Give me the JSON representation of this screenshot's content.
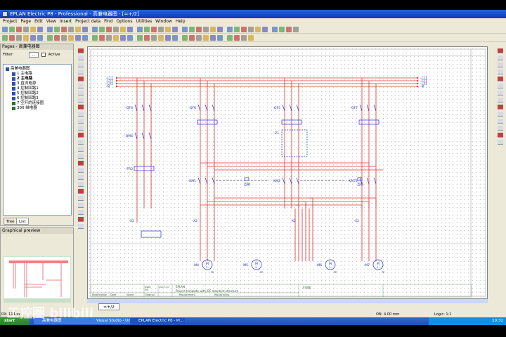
{
  "window": {
    "title": "EPLAN Electric P8 - Professional - 高兼电器图 - [=+/2]"
  },
  "menu": [
    "Project",
    "Page",
    "Edit",
    "View",
    "Insert",
    "Project data",
    "Find",
    "Options",
    "Utilities",
    "Window",
    "Help"
  ],
  "pages_panel": {
    "title": "Pages - 高兼电器图",
    "filter_label": "Filter:",
    "filter_button": "...",
    "active_label": "Active",
    "tree": [
      {
        "label": "高兼电器图",
        "bold": false
      },
      {
        "label": "1 主电路"
      },
      {
        "label": "2 主电路",
        "bold": true
      },
      {
        "label": "3 直流电源"
      },
      {
        "label": "4 控制回路1"
      },
      {
        "label": "5 控制回路2"
      },
      {
        "label": "6 控制回路3"
      },
      {
        "label": "7 空开的连接图"
      },
      {
        "label": "300 继电器"
      }
    ],
    "tabs": [
      "Tree",
      "List"
    ]
  },
  "preview_panel": {
    "title": "Graphical preview"
  },
  "schematic": {
    "bus": [
      "-L11",
      "-L21",
      "-L31",
      "-N"
    ],
    "devices": [
      "-QF4",
      "-QF6",
      "-QF5",
      "-QF7",
      "-QM4",
      "-FR2",
      "-Z1",
      "-KM1",
      "-KM2",
      "-KM72",
      "-X2",
      "-M4",
      "-M5",
      "-M6",
      "-M7"
    ],
    "interlock": "互锁",
    "motor_symbol": "M",
    "motor_sub": "3~",
    "pe": "PE"
  },
  "titleblock": {
    "company": "EPLAN",
    "description": "Project template with IEC standard structure",
    "date_label": "Date",
    "date": "2007-10",
    "ed_label": "Ed.",
    "checked_label": "Appr",
    "mod_label": "Modification",
    "date_col": "Date",
    "name_col": "Name",
    "original_label": "Original",
    "replacement_label": "Replacement",
    "replaced_by_label": "Replaced by",
    "page_title": "主电路"
  },
  "page_tab": "=+/2",
  "status": {
    "rx": "RX: 114.xx",
    "grid": "ON: 4.00 mm",
    "logic": "Logic: 1:1"
  },
  "taskbar": {
    "start": "start",
    "tasks": [
      "高兼电器图",
      "Visual Studio - Uni...",
      "EPLAN Electric P8 - Pr..."
    ],
    "clock": "10:32"
  },
  "watermark": "工控圈 bilibili",
  "colors": {
    "wire": "#e03030",
    "device": "#2030c0",
    "titlebar": "#0a3cb4"
  }
}
